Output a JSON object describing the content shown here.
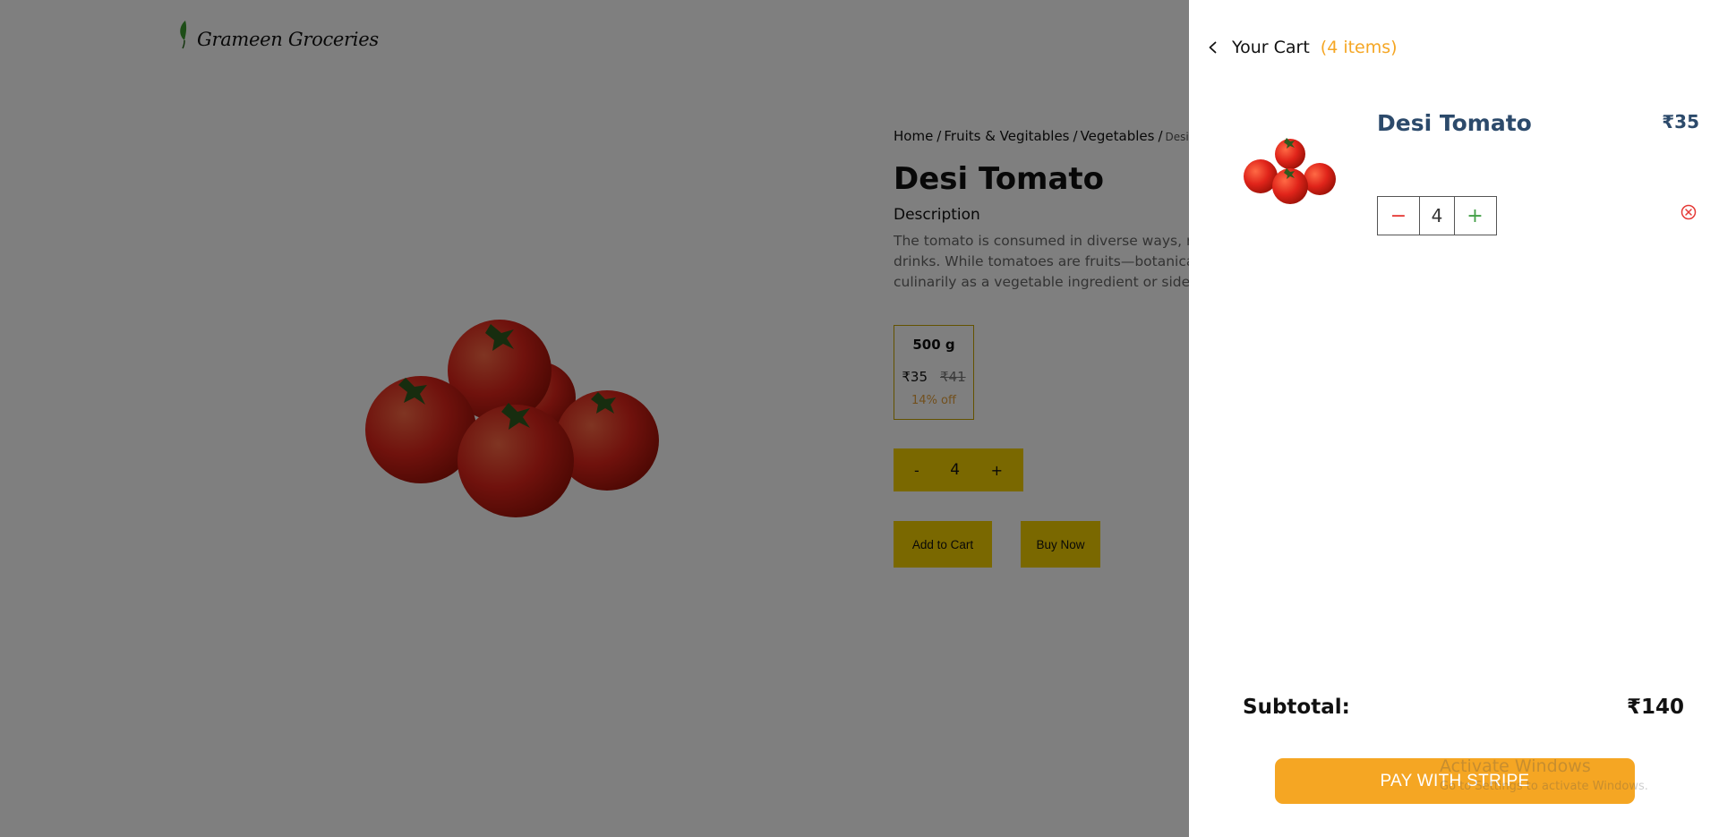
{
  "brand": {
    "name": "Grameen Groceries"
  },
  "breadcrumb": {
    "items": [
      "Home",
      "Fruits & Vegitables",
      "Vegetables"
    ],
    "separator": "/",
    "current": "Desi To"
  },
  "product": {
    "title": "Desi Tomato",
    "description_label": "Description",
    "description_lines": [
      "The tomato is consumed in diverse ways, rav",
      "drinks. While tomatoes are fruits—botanically",
      "culinarily as a vegetable ingredient or side d"
    ],
    "variant": {
      "weight": "500 g",
      "price": "₹35",
      "mrp": "₹41",
      "discount": "14% off"
    },
    "quantity": {
      "minus": "-",
      "value": "4",
      "plus": "+"
    },
    "add_to_cart_label": "Add to Cart",
    "buy_now_label": "Buy Now"
  },
  "cart": {
    "title": "Your Cart",
    "count_label": "(4 items)",
    "items": [
      {
        "name": "Desi Tomato",
        "price": "₹35",
        "quantity": "4",
        "decrement_symbol": "−",
        "increment_symbol": "+"
      }
    ],
    "subtotal_label": "Subtotal:",
    "subtotal_value": "₹140",
    "pay_button_label": "PAY WITH STRIPE"
  },
  "watermark": {
    "title": "Activate Windows",
    "subtitle": "Go to Settings to activate Windows."
  },
  "colors": {
    "brand_yellow": "#f5d000",
    "cart_orange": "#f5a623",
    "item_title_navy": "#2c4a6b",
    "remove_red": "#e53935",
    "increment_green": "#43a047"
  }
}
